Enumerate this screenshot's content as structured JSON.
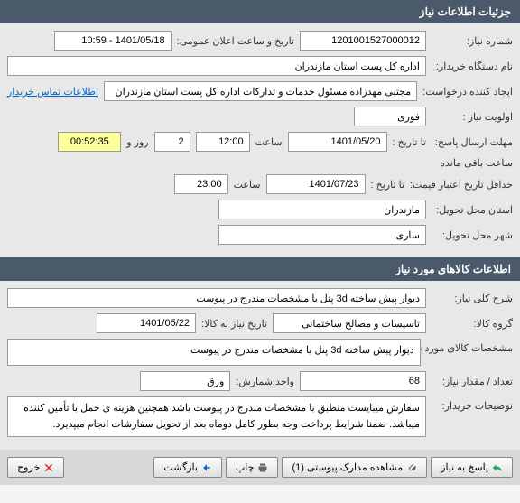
{
  "sections": {
    "need_info": "جزئیات اطلاعات نیاز",
    "goods_info": "اطلاعات کالاهای مورد نیاز"
  },
  "f": {
    "need_number_label": "شماره نیاز:",
    "need_number": "1201001527000012",
    "public_date_label": "تاریخ و ساعت اعلان عمومی:",
    "public_date": "1401/05/18 - 10:59",
    "buyer_label": "نام دستگاه خریدار:",
    "buyer": "اداره کل پست استان مازندران",
    "requester_label": "ایجاد کننده درخواست:",
    "requester": "مجتبی مهدزاده مسئول خدمات و تدارکات اداره کل پست استان مازندران",
    "contact_link": "اطلاعات تماس خریدار",
    "priority_label": "اولویت نیاز :",
    "priority": "فوری",
    "deadline_label": "مهلت ارسال پاسخ:",
    "to_date_label": "تا تاریخ :",
    "deadline_date": "1401/05/20",
    "time_label": "ساعت",
    "deadline_time": "12:00",
    "days_count": "2",
    "days_label": "روز و",
    "remaining_time": "00:52:35",
    "remaining_label": "ساعت باقی مانده",
    "validity_label": "حداقل تاریخ اعتبار قیمت:",
    "validity_date": "1401/07/23",
    "validity_time": "23:00",
    "province_label": "استان محل تحویل:",
    "province": "مازندران",
    "city_label": "شهر محل تحویل:",
    "city": "ساری",
    "desc_label": "شرح کلی نیاز:",
    "desc": "دیوار پیش ساخته 3d پنل با مشخصات مندرج در پیوست",
    "group_label": "گروه کالا:",
    "group": "تاسیسات و مصالح ساختمانی",
    "need_by_label": "تاریخ نیاز به کالا:",
    "need_by": "1401/05/22",
    "spec_label": "مشخصات کالای مورد نیاز:",
    "spec": "دیوار پیش ساخته 3d پنل با مشخصات مندرج در پیوست",
    "qty_label": "تعداد / مقدار نیاز:",
    "qty": "68",
    "unit_label": "واحد شمارش:",
    "unit": "ورق",
    "notes_label": "توضیحات خریدار:",
    "notes": "سفارش میبایست منطبق با مشخصات مندرج در پیوست باشد همچنین هزینه ی حمل با تأمین کننده میباشد. ضمنا شرایط پرداخت وجه بطور کامل دوماه بعد از تحویل سفارشات انجام میپذیرد."
  },
  "buttons": {
    "respond": "پاسخ به نیاز",
    "attachments": "مشاهده مدارک پیوستی (1)",
    "print": "چاپ",
    "back": "بازگشت",
    "exit": "خروج"
  }
}
